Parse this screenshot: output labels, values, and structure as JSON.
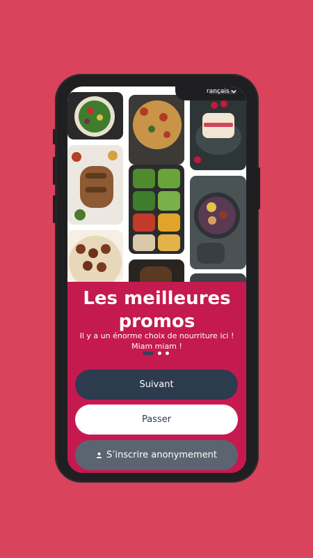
{
  "language_selector": {
    "label": "rançais",
    "icon": "chevron-down-icon"
  },
  "onboarding": {
    "title_line1": "Les meilleures",
    "title_line2": "promos",
    "subtitle": "Il y a un énorme choix de nourriture ici ! Miam miam !",
    "page_indicator": {
      "count": 3,
      "active_index": 0
    }
  },
  "buttons": {
    "next": "Suivant",
    "skip": "Passer",
    "anonymous": "S’inscrire anonymement",
    "anonymous_icon": "person-icon"
  },
  "colors": {
    "background": "#d9435b",
    "accent": "#c41a50",
    "primary_button": "#2d3b4f",
    "secondary_button": "#5b6571"
  }
}
